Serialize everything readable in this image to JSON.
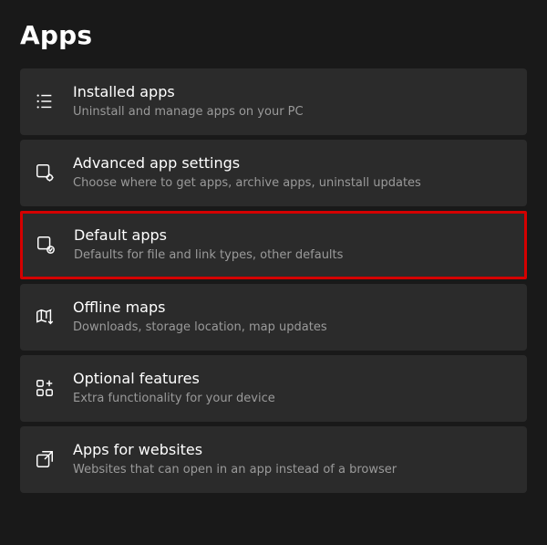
{
  "page": {
    "title": "Apps"
  },
  "items": [
    {
      "id": "installed-apps",
      "icon": "list-icon",
      "label": "Installed apps",
      "desc": "Uninstall and manage apps on your PC",
      "highlight": false
    },
    {
      "id": "advanced-app-settings",
      "icon": "app-gear-icon",
      "label": "Advanced app settings",
      "desc": "Choose where to get apps, archive apps, uninstall updates",
      "highlight": false
    },
    {
      "id": "default-apps",
      "icon": "app-check-icon",
      "label": "Default apps",
      "desc": "Defaults for file and link types, other defaults",
      "highlight": true
    },
    {
      "id": "offline-maps",
      "icon": "map-download-icon",
      "label": "Offline maps",
      "desc": "Downloads, storage location, map updates",
      "highlight": false
    },
    {
      "id": "optional-features",
      "icon": "app-plus-icon",
      "label": "Optional features",
      "desc": "Extra functionality for your device",
      "highlight": false
    },
    {
      "id": "apps-for-websites",
      "icon": "open-external-icon",
      "label": "Apps for websites",
      "desc": "Websites that can open in an app instead of a browser",
      "highlight": false
    }
  ]
}
